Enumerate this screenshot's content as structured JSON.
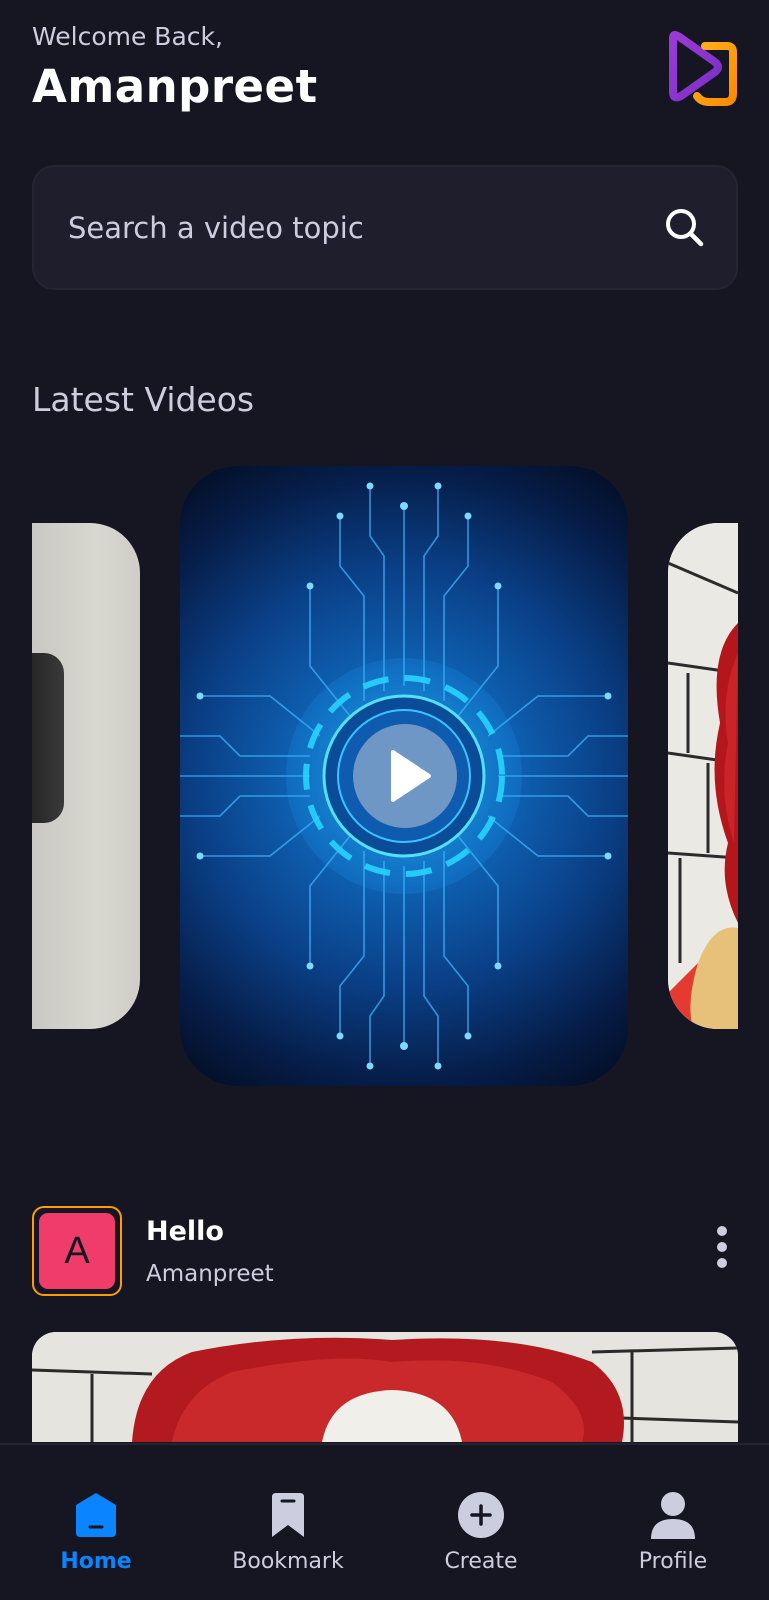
{
  "header": {
    "welcome": "Welcome Back,",
    "username": "Amanpreet",
    "logo_icon": "app-logo-icon"
  },
  "search": {
    "placeholder": "Search a video topic",
    "icon": "search-icon"
  },
  "latest": {
    "title": "Latest Videos"
  },
  "post": {
    "avatar_letter": "A",
    "title": "Hello",
    "author": "Amanpreet",
    "menu_icon": "more-vertical-icon"
  },
  "tabs": [
    {
      "label": "Home",
      "icon": "home-icon",
      "active": true
    },
    {
      "label": "Bookmark",
      "icon": "bookmark-icon",
      "active": false
    },
    {
      "label": "Create",
      "icon": "plus-circle-icon",
      "active": false
    },
    {
      "label": "Profile",
      "icon": "profile-icon",
      "active": false
    }
  ],
  "colors": {
    "background": "#161622",
    "surface": "#1e1e2d",
    "accent_orange": "#ff9c01",
    "accent_purple": "#9b3bd6",
    "active_tab": "#0a84ff",
    "avatar_bg": "#ef3c6a",
    "muted_text": "#cdcde0"
  }
}
